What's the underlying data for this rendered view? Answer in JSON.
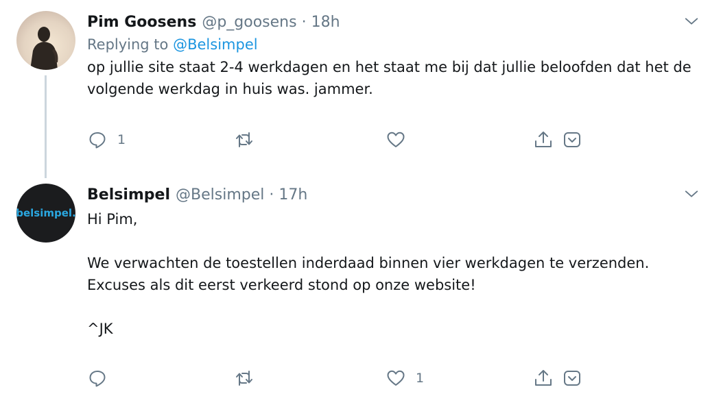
{
  "tweets": [
    {
      "display_name": "Pim Goosens",
      "handle": "@p_goosens",
      "separator": "·",
      "time": "18h",
      "replying_label": "Replying to",
      "replying_mention": "@Belsimpel",
      "text": "op jullie site staat 2-4 werkdagen en het staat me bij dat jullie beloofden dat het de volgende werkdag in huis was. jammer.",
      "reply_count": "1",
      "retweet_count": "",
      "like_count": ""
    },
    {
      "display_name": "Belsimpel",
      "handle": "@Belsimpel",
      "separator": "·",
      "time": "17h",
      "avatar_logo_text": "belsimpel.",
      "text": "Hi Pim,\n\nWe verwachten de toestellen inderdaad binnen vier werkdagen te verzenden. Excuses als dit eerst verkeerd stond op onze website!\n\n^JK",
      "reply_count": "",
      "retweet_count": "",
      "like_count": "1"
    }
  ],
  "colors": {
    "text_primary": "#14171a",
    "text_secondary": "#657786",
    "link": "#1b95e0",
    "thread_line": "#ccd6dd",
    "belsimpel_avatar_bg": "#1b1c1e",
    "belsimpel_logo": "#2aa7e0"
  },
  "icons": {
    "caret": "chevron-down-icon",
    "reply": "reply-icon",
    "retweet": "retweet-icon",
    "like": "heart-icon",
    "share": "share-icon",
    "other": "dropdown-box-icon"
  }
}
